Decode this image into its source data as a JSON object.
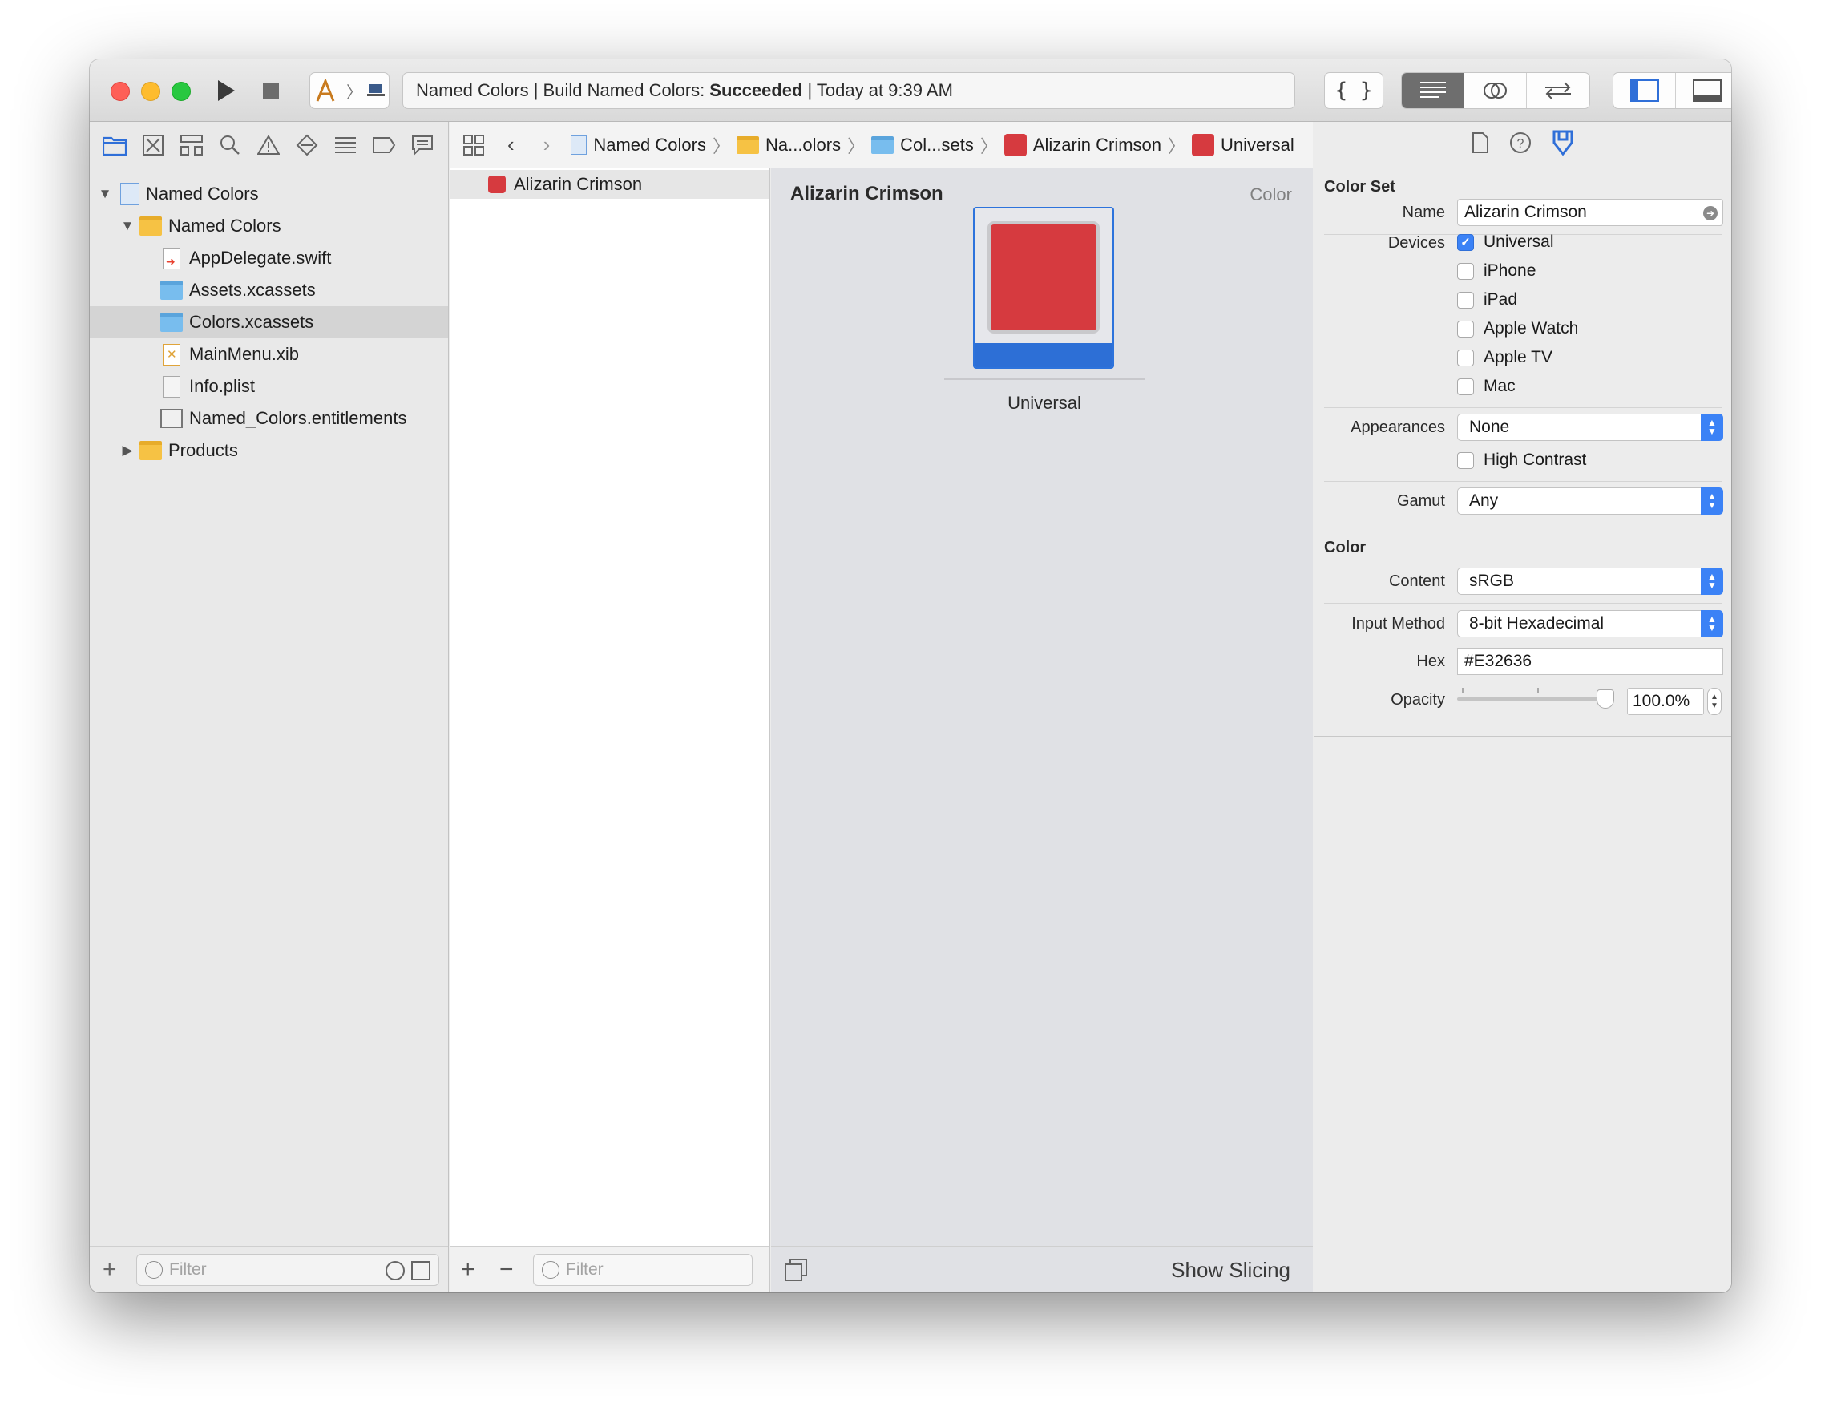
{
  "toolbar": {
    "activity_prefix": "Named Colors | Build Named Colors:",
    "activity_status": "Succeeded",
    "activity_suffix": "| Today at 9:39 AM",
    "colors": {
      "close": "#fe5f57",
      "minimize": "#febc2e",
      "zoom": "#28c840"
    }
  },
  "navigator": {
    "tree": [
      {
        "label": "Named Colors",
        "icon": "project-icon"
      },
      {
        "label": "Named Colors",
        "icon": "folder-icon"
      },
      {
        "label": "AppDelegate.swift",
        "icon": "swift-file-icon"
      },
      {
        "label": "Assets.xcassets",
        "icon": "asset-catalog-icon"
      },
      {
        "label": "Colors.xcassets",
        "icon": "asset-catalog-icon"
      },
      {
        "label": "MainMenu.xib",
        "icon": "xib-file-icon"
      },
      {
        "label": "Info.plist",
        "icon": "plist-file-icon"
      },
      {
        "label": "Named_Colors.entitlements",
        "icon": "entitlements-file-icon"
      },
      {
        "label": "Products",
        "icon": "folder-icon"
      }
    ],
    "filter_placeholder": "Filter"
  },
  "jumpbar": {
    "crumbs": [
      "Named Colors",
      "Na...olors",
      "Col...sets",
      "Alizarin Crimson",
      "Universal"
    ]
  },
  "setlist": {
    "item": "Alizarin Crimson",
    "filter_placeholder": "Filter"
  },
  "editor": {
    "title": "Alizarin Crimson",
    "kind": "Color",
    "well_label": "Universal",
    "show_slicing": "Show Slicing",
    "swatch_color": "#d63a3f"
  },
  "inspector": {
    "color_set_title": "Color Set",
    "name_label": "Name",
    "name_value": "Alizarin Crimson",
    "devices_label": "Devices",
    "devices": [
      {
        "label": "Universal",
        "checked": true
      },
      {
        "label": "iPhone",
        "checked": false
      },
      {
        "label": "iPad",
        "checked": false
      },
      {
        "label": "Apple Watch",
        "checked": false
      },
      {
        "label": "Apple TV",
        "checked": false
      },
      {
        "label": "Mac",
        "checked": false
      }
    ],
    "appearances_label": "Appearances",
    "appearances_value": "None",
    "high_contrast_label": "High Contrast",
    "gamut_label": "Gamut",
    "gamut_value": "Any",
    "color_title": "Color",
    "content_label": "Content",
    "content_value": "sRGB",
    "input_method_label": "Input Method",
    "input_method_value": "8-bit Hexadecimal",
    "hex_label": "Hex",
    "hex_value": "#E32636",
    "opacity_label": "Opacity",
    "opacity_value": "100.0%",
    "opacity_level": 1.0,
    "accent": "#3b82f6"
  }
}
